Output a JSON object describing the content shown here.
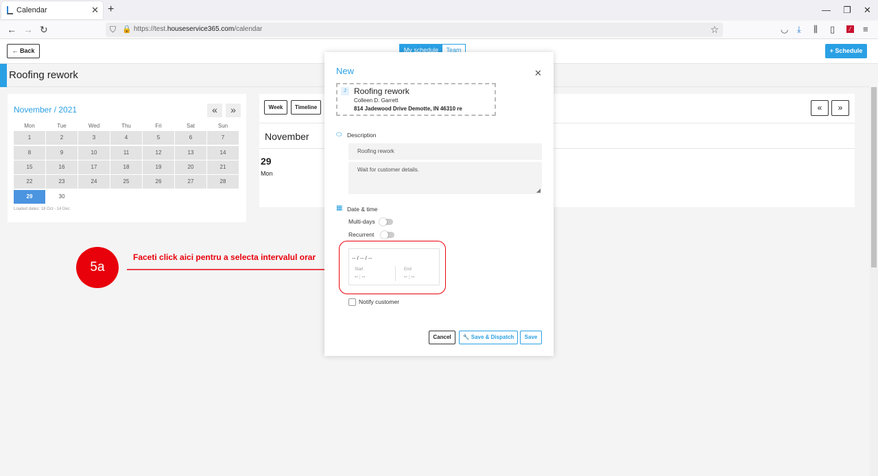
{
  "browser": {
    "tab_title": "Calendar",
    "url_prefix": "https://test.",
    "url_domain": "houseservice365.com",
    "url_path": "/calendar"
  },
  "header": {
    "back_label": "Back",
    "my_schedule_label": "My schedule",
    "team_label": "Team",
    "schedule_label": "Schedule"
  },
  "job_title": "Roofing rework",
  "minical": {
    "month_label": "November / 2021",
    "prev": "«",
    "next": "»",
    "weekdays": [
      "Mon",
      "Tue",
      "Wed",
      "Thu",
      "Fri",
      "Sat",
      "Sun"
    ],
    "days": [
      "1",
      "2",
      "3",
      "4",
      "5",
      "6",
      "7",
      "8",
      "9",
      "10",
      "11",
      "12",
      "13",
      "14",
      "15",
      "16",
      "17",
      "18",
      "19",
      "20",
      "21",
      "22",
      "23",
      "24",
      "25",
      "26",
      "27",
      "28",
      "29",
      "30"
    ],
    "selected_day": "29",
    "loaded_dates": "Loaded dates: 18 Oct - 14 Dec"
  },
  "calendar_view": {
    "week_label": "Week",
    "timeline_label": "Timeline",
    "month_heading": "November",
    "day_number": "29",
    "day_name": "Mon"
  },
  "annotation": {
    "step": "5a",
    "text": "Faceti click aici pentru a selecta intervalul orar"
  },
  "modal": {
    "title": "New",
    "job": {
      "badge": "J",
      "title": "Roofing rework",
      "customer": "Colleen D. Garrett",
      "address": "814 Jadewood Drive Demotte, IN 46310 re"
    },
    "description_label": "Description",
    "description_title": "Roofing rework",
    "description_body": "Wait for customer details.",
    "datetime_label": "Date & time",
    "multidays_label": "Multi-days",
    "recurrent_label": "Recurrent",
    "date_placeholder": "-- / -- / --",
    "start_label": "Start",
    "start_value": "-- : --",
    "end_label": "End",
    "end_value": "-- : --",
    "notify_label": "Notify customer",
    "cancel_label": "Cancel",
    "save_dispatch_label": "Save & Dispatch",
    "save_label": "Save"
  },
  "colors": {
    "accent": "#2aa0e4",
    "annotation_red": "#e8000b",
    "selected_day": "#4b94e0"
  }
}
